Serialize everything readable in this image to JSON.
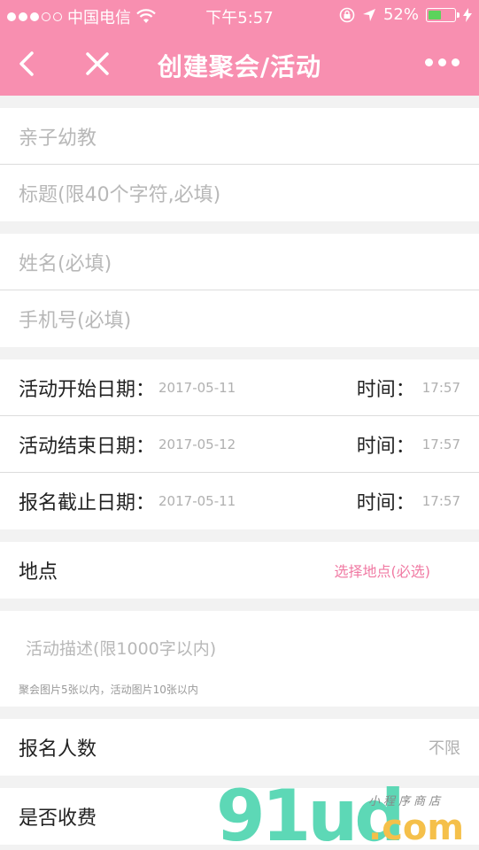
{
  "status_bar": {
    "carrier": "中国电信",
    "time": "下午5:57",
    "battery": "52%",
    "battery_level": 0.52
  },
  "nav": {
    "title": "创建聚会/活动"
  },
  "form": {
    "category_placeholder": "亲子幼教",
    "title_placeholder": "标题(限40个字符,必填)",
    "name_placeholder": "姓名(必填)",
    "phone_placeholder": "手机号(必填)",
    "time_label": "时间：",
    "start": {
      "label": "活动开始日期：",
      "date": "2017-05-11",
      "time": "17:57"
    },
    "end": {
      "label": "活动结束日期：",
      "date": "2017-05-12",
      "time": "17:57"
    },
    "deadline": {
      "label": "报名截止日期：",
      "date": "2017-05-11",
      "time": "17:57"
    },
    "location": {
      "label": "地点",
      "action": "选择地点(必选)"
    },
    "description_placeholder": "活动描述(限1000字以内)",
    "image_hint": "聚会图片5张以内，活动图片10张以内",
    "signup_count": {
      "label": "报名人数",
      "value": "不限"
    },
    "fee": {
      "label": "是否收费"
    }
  },
  "watermark": {
    "big": "91ud",
    "com": ".com",
    "small": "小程序商店"
  },
  "colors": {
    "header": "#f88fb0",
    "link": "#f07aa3",
    "watermark_green": "#5dd8b6",
    "watermark_orange": "#f5c04a"
  }
}
